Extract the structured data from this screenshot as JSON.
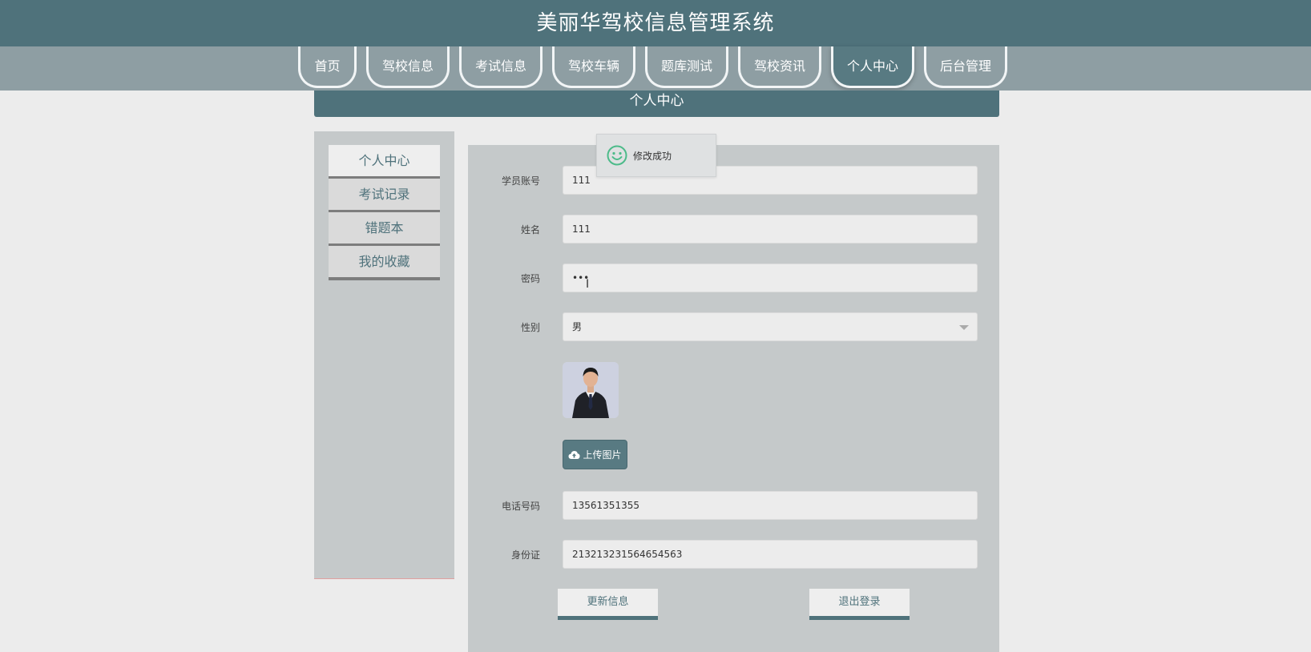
{
  "header": {
    "title": "美丽华驾校信息管理系统"
  },
  "nav": {
    "items": [
      {
        "label": "首页"
      },
      {
        "label": "驾校信息"
      },
      {
        "label": "考试信息"
      },
      {
        "label": "驾校车辆"
      },
      {
        "label": "题库测试"
      },
      {
        "label": "驾校资讯"
      },
      {
        "label": "个人中心",
        "active": true
      },
      {
        "label": "后台管理"
      }
    ]
  },
  "section": {
    "title": "个人中心"
  },
  "sidebar": {
    "items": [
      {
        "label": "个人中心",
        "active": true
      },
      {
        "label": "考试记录"
      },
      {
        "label": "错题本"
      },
      {
        "label": "我的收藏"
      }
    ]
  },
  "form": {
    "account": {
      "label": "学员账号",
      "value": "111"
    },
    "name": {
      "label": "姓名",
      "value": "111"
    },
    "password": {
      "label": "密码",
      "value": "•••"
    },
    "gender": {
      "label": "性别",
      "value": "男"
    },
    "upload_label": "上传图片",
    "phone": {
      "label": "电话号码",
      "value": "13561351355"
    },
    "id_card": {
      "label": "身份证",
      "value": "213213231564654563"
    },
    "update_label": "更新信息",
    "logout_label": "退出登录"
  },
  "toast": {
    "message": "修改成功"
  },
  "colors": {
    "primary": "#4f727b",
    "nav_bg": "#8e9ea3",
    "panel_bg": "#c5c9ca",
    "page_bg": "#ececec",
    "success_icon": "#4dbb8a"
  },
  "icons": {
    "toast": "smile-icon",
    "upload": "cloud-upload-icon",
    "select": "chevron-down-icon",
    "cursor": "text-cursor-icon"
  }
}
